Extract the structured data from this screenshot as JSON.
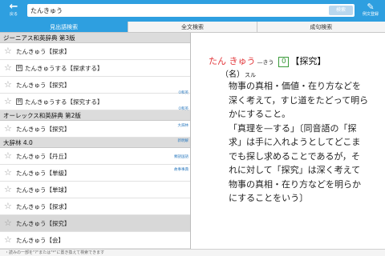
{
  "header": {
    "back_label": "戻る",
    "search_value": "たんきゅう",
    "search_button": "検索",
    "history_label": "例文登録"
  },
  "tabs": [
    {
      "label": "見出語検索",
      "active": true
    },
    {
      "label": "全文検索",
      "active": false
    },
    {
      "label": "成句検索",
      "active": false
    }
  ],
  "results": {
    "sections": [
      {
        "title": "ジーニアス和英辞典 第3版",
        "items": [
          {
            "text": "たんきゅう【探求】",
            "badge": ""
          },
          {
            "text": "たんきゅうする【探求する】",
            "badge": "例"
          },
          {
            "text": "たんきゅう【探究】",
            "badge": ""
          },
          {
            "text": "たんきゅうする【探究する】",
            "badge": "例"
          }
        ]
      },
      {
        "title": "オーレックス和英辞典 第2版",
        "items": [
          {
            "text": "たんきゅう【探究】",
            "badge": ""
          }
        ]
      },
      {
        "title": "大辞林 4.0",
        "items": [
          {
            "text": "たんきゅう【丹丘】",
            "badge": ""
          },
          {
            "text": "たんきゅう【単級】",
            "badge": ""
          },
          {
            "text": "たんきゅう【単球】",
            "badge": ""
          },
          {
            "text": "たんきゅう【探求】",
            "badge": ""
          },
          {
            "text": "たんきゅう【探究】",
            "badge": ""
          },
          {
            "text": "たんきゅう【会】",
            "badge": ""
          }
        ]
      }
    ],
    "side_tags": [
      "O和英",
      "O和英",
      "大辞林",
      "新明解",
      "類語国語",
      "故事事典"
    ]
  },
  "entry": {
    "reading": "たん きゅう",
    "kana_note": "—きう",
    "box": "0",
    "kanji": "【探究】",
    "pos": "（名）",
    "pos_suffix": "スル",
    "lines": [
      "物事の真相・価値・在り方などを",
      "深く考えて，すじ道をたどって明ら",
      "かにすること。",
      "「真理を—する」〔同音語の「探",
      "求」は手に入れようとしてどこま",
      "でも探し求めることであるが，そ",
      "れに対して「探究」は深く考えて",
      "物事の真相・在り方などを明らか",
      "にすることをいう〕"
    ]
  },
  "footer": {
    "hint": "・読みの一部を\"?\"または\"*\"に置き換えて検索できます"
  },
  "colors": {
    "accent": "#2e9fe0",
    "reading": "#e2383c",
    "box_border": "#3a9a3a"
  },
  "icons": {
    "back": "back-arrow-icon",
    "history": "pencil-icon",
    "star": "star-icon",
    "example_badge": "example-badge-icon"
  }
}
